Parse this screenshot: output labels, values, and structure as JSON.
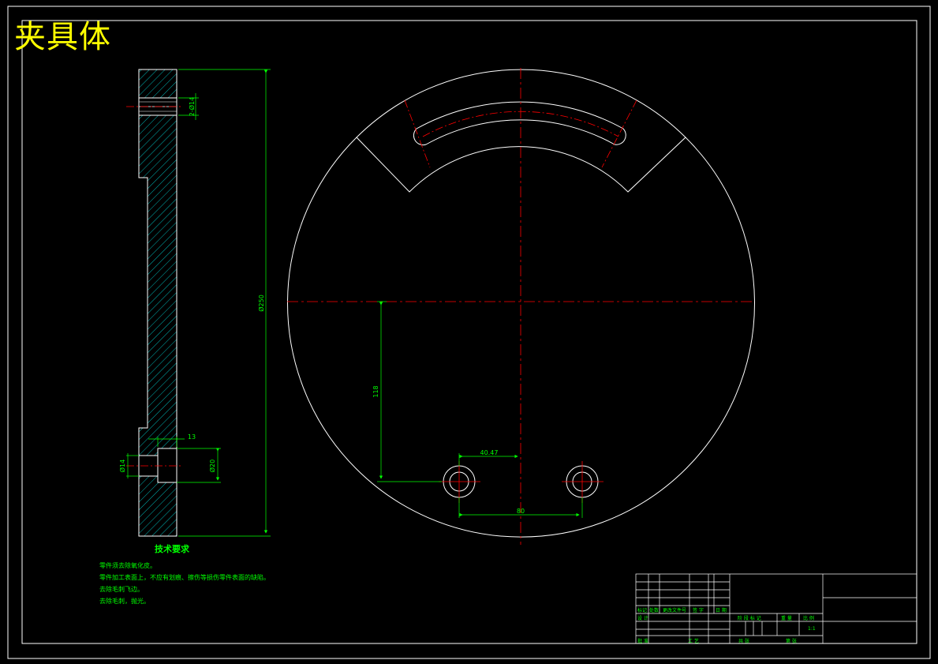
{
  "drawing_title": "夹具体",
  "side_view": {
    "dim_overall": "Ø250",
    "dim_slot": "2-Ø14",
    "dim_small_hole": "Ø14",
    "dim_counterbore": "Ø20",
    "dim_depth": "13"
  },
  "front_view": {
    "dim_vertical": "118",
    "dim_half_spacing": "40.47",
    "dim_hole_spacing": "80"
  },
  "technical_requirements": {
    "heading": "技术要求",
    "notes": [
      "零件须去除氧化皮。",
      "零件加工表面上，不应有划痕、擦伤等损伤零件表面的缺陷。",
      "去除毛刺飞边。",
      "去除毛刺，抛光。"
    ]
  },
  "title_block": {
    "row_labels_1": [
      "标记",
      "处数",
      "更改文件号",
      "签 字",
      "日 期"
    ],
    "design": "设 计",
    "stage_headers": [
      "阶 段 标 记",
      "重 量",
      "比 例"
    ],
    "scale": "1:1",
    "sheet_labels": [
      "共 张",
      "第 张"
    ],
    "process": "工 艺",
    "approve": "批 准"
  },
  "colors": {
    "outline": "#ffffff",
    "dimension": "#00ff00",
    "centerline": "#ff0000",
    "hatch": "#00ffff",
    "title": "#ffff00"
  }
}
